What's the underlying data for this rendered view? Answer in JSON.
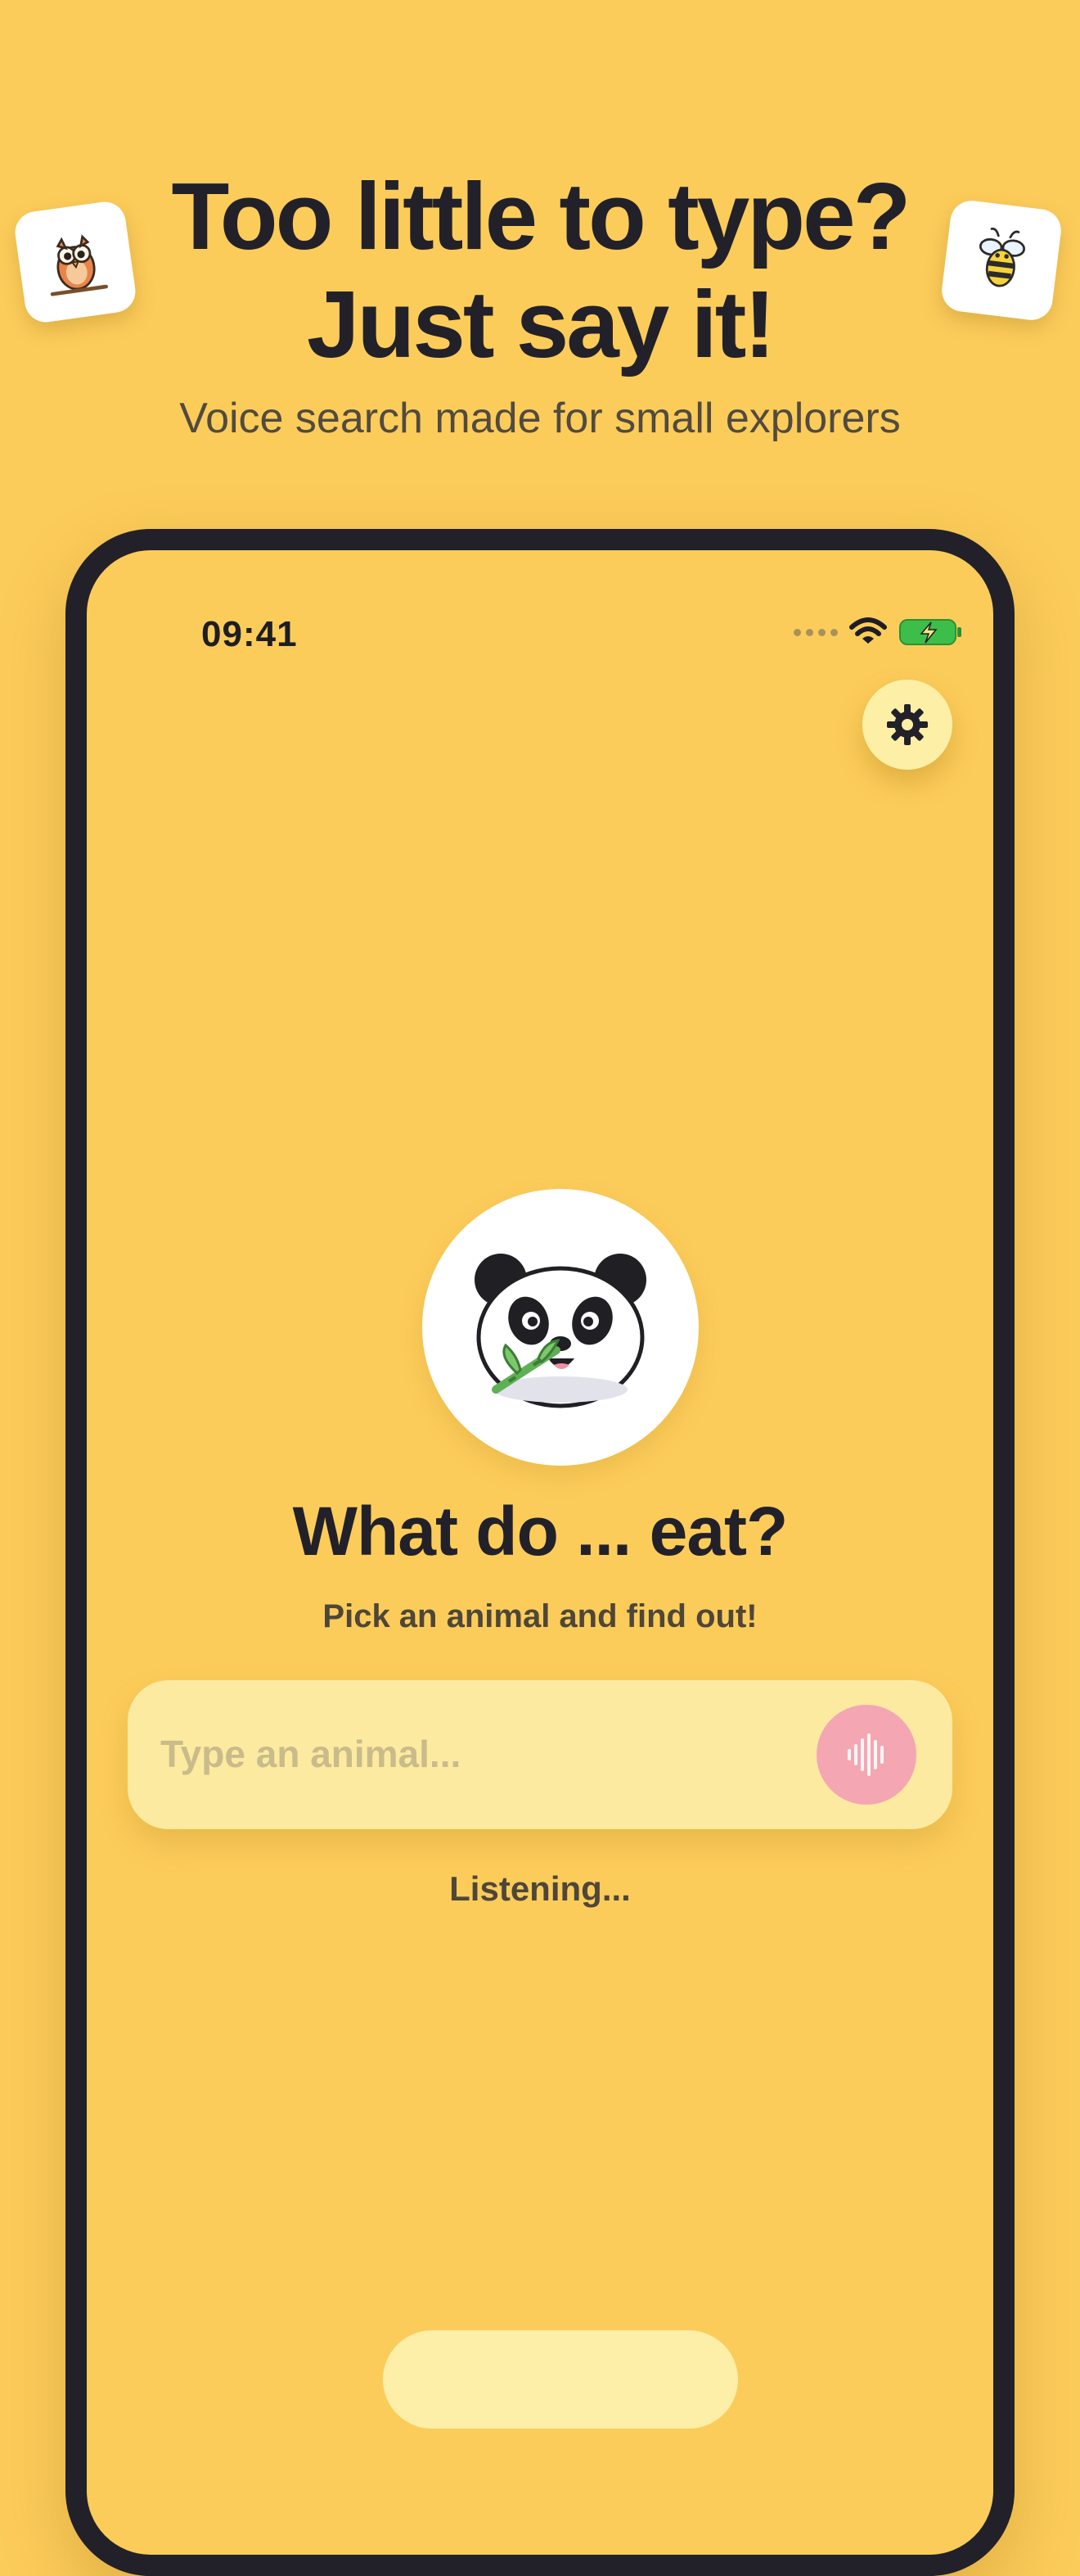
{
  "marketing": {
    "headline_line1": "Too little to type?",
    "headline_line2": "Just say it!",
    "subheadline": "Voice search made for small explorers",
    "sticker_left_icon": "owl-icon",
    "sticker_right_icon": "bee-icon"
  },
  "status_bar": {
    "time": "09:41",
    "icons": [
      "signal-dots-icon",
      "wifi-icon",
      "battery-charging-icon"
    ]
  },
  "settings": {
    "icon": "gear-icon"
  },
  "main": {
    "avatar_icon": "panda-icon",
    "title": "What do ... eat?",
    "subtitle": "Pick an animal and find out!",
    "search": {
      "value": "",
      "placeholder": "Type an animal..."
    },
    "mic_icon": "sound-wave-icon",
    "status": "Listening..."
  },
  "colors": {
    "background": "#FCCC5A",
    "text": "#22212A",
    "search_bar": "#FCEAA0",
    "mic_button": "#F5A6B3",
    "settings_button": "#FDF0A6",
    "battery": "#3DBE4A"
  }
}
